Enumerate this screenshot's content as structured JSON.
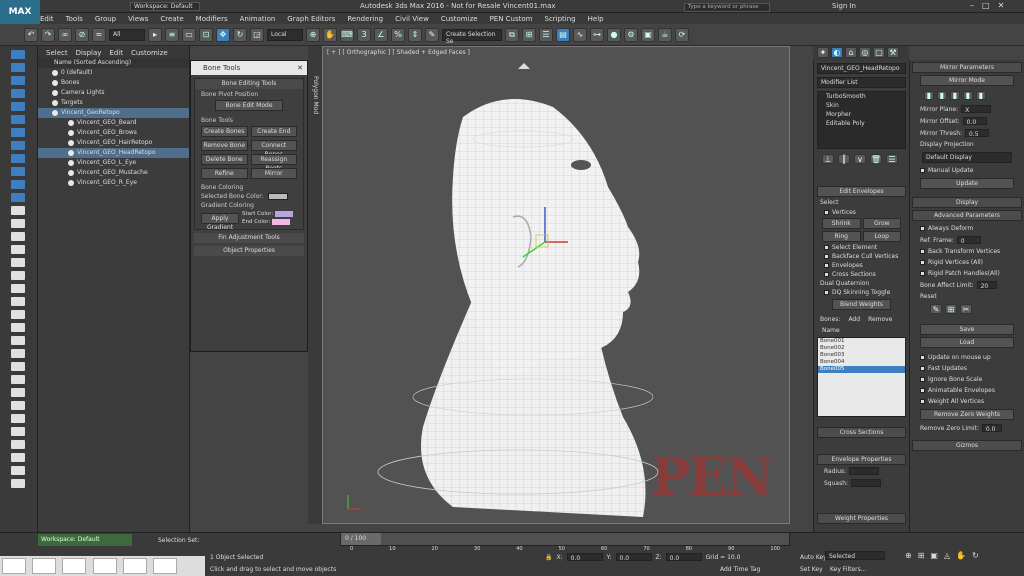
{
  "window": {
    "title": "Autodesk 3ds Max 2016 - Not for Resale    Vincent01.max",
    "workspace": "Workspace: Default",
    "search_placeholder": "Type a keyword or phrase",
    "sign_in": "Sign In"
  },
  "menu": [
    "Edit",
    "Tools",
    "Group",
    "Views",
    "Create",
    "Modifiers",
    "Animation",
    "Graph Editors",
    "Rendering",
    "Civil View",
    "Customize",
    "PEN Custom",
    "Scripting",
    "Help"
  ],
  "toolbar": {
    "filter": "All",
    "coord": "Local",
    "selection_set": "Create Selection Se"
  },
  "scene_explorer": {
    "tabs": [
      "Select",
      "Display",
      "Edit",
      "Customize"
    ],
    "header": "Name (Sorted Ascending)",
    "items": [
      {
        "name": "0 (default)",
        "selected": false
      },
      {
        "name": "Bones",
        "selected": false
      },
      {
        "name": "Camera Lights",
        "selected": false
      },
      {
        "name": "Targets",
        "selected": false
      },
      {
        "name": "Vincent_GeoRetopo",
        "selected": true
      },
      {
        "name": "Vincent_GEO_Beard",
        "selected": false
      },
      {
        "name": "Vincent_GEO_Brows",
        "selected": false
      },
      {
        "name": "Vincent_GEO_HairRetopo",
        "selected": false
      },
      {
        "name": "Vincent_GEO_HeadRetopo",
        "selected": true
      },
      {
        "name": "Vincent_GEO_L_Eye",
        "selected": false
      },
      {
        "name": "Vincent_GEO_Mustache",
        "selected": false
      },
      {
        "name": "Vincent_GEO_R_Eye",
        "selected": false
      }
    ]
  },
  "bone_tools": {
    "title": "Bone Tools",
    "editing_head": "Bone Editing Tools",
    "pivot_label": "Bone Pivot Position",
    "bone_edit_mode": "Bone Edit Mode",
    "tools_label": "Bone Tools",
    "buttons": [
      "Create Bones",
      "Create End",
      "Remove Bone",
      "Connect Bones",
      "Delete Bone",
      "Reassign Roots",
      "Refine",
      "Mirror"
    ],
    "coloring_label": "Bone Coloring",
    "selected_color_label": "Selected Bone Color:",
    "gradient_label": "Gradient Coloring",
    "apply_gradient": "Apply Gradient",
    "start_color": "Start Color:",
    "end_color": "End Color:",
    "fin_head": "Fin Adjustment Tools",
    "object_head": "Object Properties"
  },
  "viewport": {
    "label": "[ + ] [ Orthographic ] [ Shaded + Edged Faces ]",
    "side_tab": "Polygon Mod"
  },
  "modify_panel": {
    "object_name": "Vincent_GEO_HeadRetopo",
    "modifier_list": "Modifier List",
    "stack": [
      "TurboSmooth",
      "Skin",
      "Morpher",
      "Editable Poly"
    ],
    "edit_envelopes": "Edit Envelopes",
    "select_label": "Select",
    "filters": [
      "Vertices",
      "Select Element",
      "Backface Cull Vertices",
      "Envelopes",
      "Cross Sections"
    ],
    "shrink": "Shrink",
    "grow": "Grow",
    "ring": "Ring",
    "loop": "Loop",
    "dual_quat": "Dual Quaternion",
    "dq_toggle": "DQ Skinning Toggle",
    "blend_weights": "Blend Weights",
    "bones_label": "Bones:",
    "add": "Add",
    "remove": "Remove",
    "name_label": "Name",
    "bones": [
      {
        "name": "Bone001",
        "selected": false
      },
      {
        "name": "Bone002",
        "selected": false
      },
      {
        "name": "Bone003",
        "selected": false
      },
      {
        "name": "Bone004",
        "selected": false
      },
      {
        "name": "Bone005",
        "selected": true
      }
    ],
    "cross_sections": "Cross Sections",
    "envelope_props": "Envelope Properties",
    "radius_label": "Radius:",
    "squash_label": "Squash:",
    "weight_props": "Weight Properties"
  },
  "mirror_panel": {
    "head": "Mirror Parameters",
    "mirror_mode": "Mirror Mode",
    "mirror_plane": "Mirror Plane:",
    "mirror_plane_val": "X",
    "mirror_offset": "Mirror Offset:",
    "mirror_offset_val": "0.0",
    "mirror_thresh": "Mirror Thresh:",
    "mirror_thresh_val": "0.5",
    "display_projection": "Display Projection",
    "default_display": "Default Display",
    "manual_update": "Manual Update",
    "update": "Update",
    "display": "Display",
    "advanced": "Advanced Parameters",
    "always_deform": "Always Deform",
    "ref_frame": "Ref. Frame:",
    "ref_frame_val": "0",
    "back_transform": "Back Transform Vertices",
    "rigid_vertices": "Rigid Vertices (All)",
    "rigid_patch": "Rigid Patch Handles(All)",
    "bone_affect": "Bone Affect Limit:",
    "bone_affect_val": "20",
    "reset": "Reset",
    "save": "Save",
    "load": "Load",
    "update_mouse_up": "Update on mouse up",
    "fast_updates": "Fast Updates",
    "ignore_bone_scale": "Ignore Bone Scale",
    "animatable_env": "Animatable Envelopes",
    "weight_all": "Weight All Vertices",
    "remove_zero": "Remove Zero Weights",
    "remove_zero_limit": "Remove Zero Limit:",
    "remove_zero_val": "0.0",
    "gizmos": "Gizmos"
  },
  "status": {
    "workspace": "Workspace: Default",
    "selection_set": "Selection Set:",
    "frame": "0 / 100",
    "objects": "1 Object Selected",
    "hint": "Click and drag to select and move objects",
    "x": "0.0",
    "y": "0.0",
    "z": "0.0",
    "grid": "Grid = 10.0",
    "add_time_tag": "Add Time Tag",
    "auto_key": "Auto Key",
    "auto_sel": "Selected",
    "set_key": "Set Key",
    "key_filters": "Key Filters...",
    "ticks": [
      "0",
      "10",
      "20",
      "30",
      "40",
      "50",
      "60",
      "70",
      "80",
      "90",
      "100"
    ]
  },
  "watermark": "PEN"
}
